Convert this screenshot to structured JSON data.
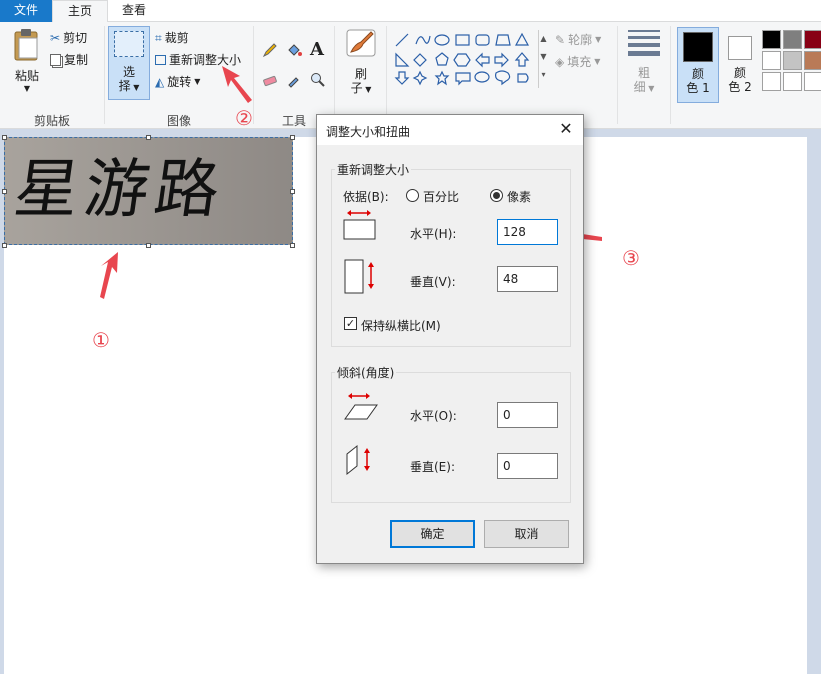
{
  "tabs": {
    "file": "文件",
    "home": "主页",
    "view": "查看"
  },
  "clipboard": {
    "paste": "粘贴",
    "cut": "剪切",
    "copy": "复制",
    "label": "剪贴板"
  },
  "image_group": {
    "select": "选",
    "select2": "择",
    "crop": "裁剪",
    "resize": "重新调整大小",
    "rotate": "旋转",
    "label": "图像"
  },
  "tools": {
    "label": "工具"
  },
  "brush": {
    "line1": "刷",
    "line2": "子"
  },
  "shapes": {
    "outline": "轮廓",
    "fill": "填充"
  },
  "size": {
    "line1": "粗",
    "line2": "细"
  },
  "colors": {
    "color1_line1": "颜",
    "color1_line2": "色 1",
    "color2_line1": "颜",
    "color2_line2": "色 2",
    "color1": "#000000",
    "color2": "#ffffff",
    "palette": [
      "#000000",
      "#7f7f7f",
      "#880015",
      "#ffffff",
      "#c3c3c3",
      "#b97a57",
      "#ffffff",
      "#ffffff",
      "#ffffff"
    ]
  },
  "canvas_text": "星游路",
  "annotations": {
    "a1": "①",
    "a2": "②",
    "a3": "③"
  },
  "dialog": {
    "title": "调整大小和扭曲",
    "close": "✕",
    "resize_legend": "重新调整大小",
    "by_label": "依据(B):",
    "percent": "百分比",
    "pixels": "像素",
    "horizontal_label": "水平(H):",
    "horizontal_value": "128",
    "vertical_label": "垂直(V):",
    "vertical_value": "48",
    "keep_ratio": "保持纵横比(M)",
    "skew_legend": "倾斜(角度)",
    "skew_h_label": "水平(O):",
    "skew_h_value": "0",
    "skew_v_label": "垂直(E):",
    "skew_v_value": "0",
    "ok": "确定",
    "cancel": "取消"
  }
}
